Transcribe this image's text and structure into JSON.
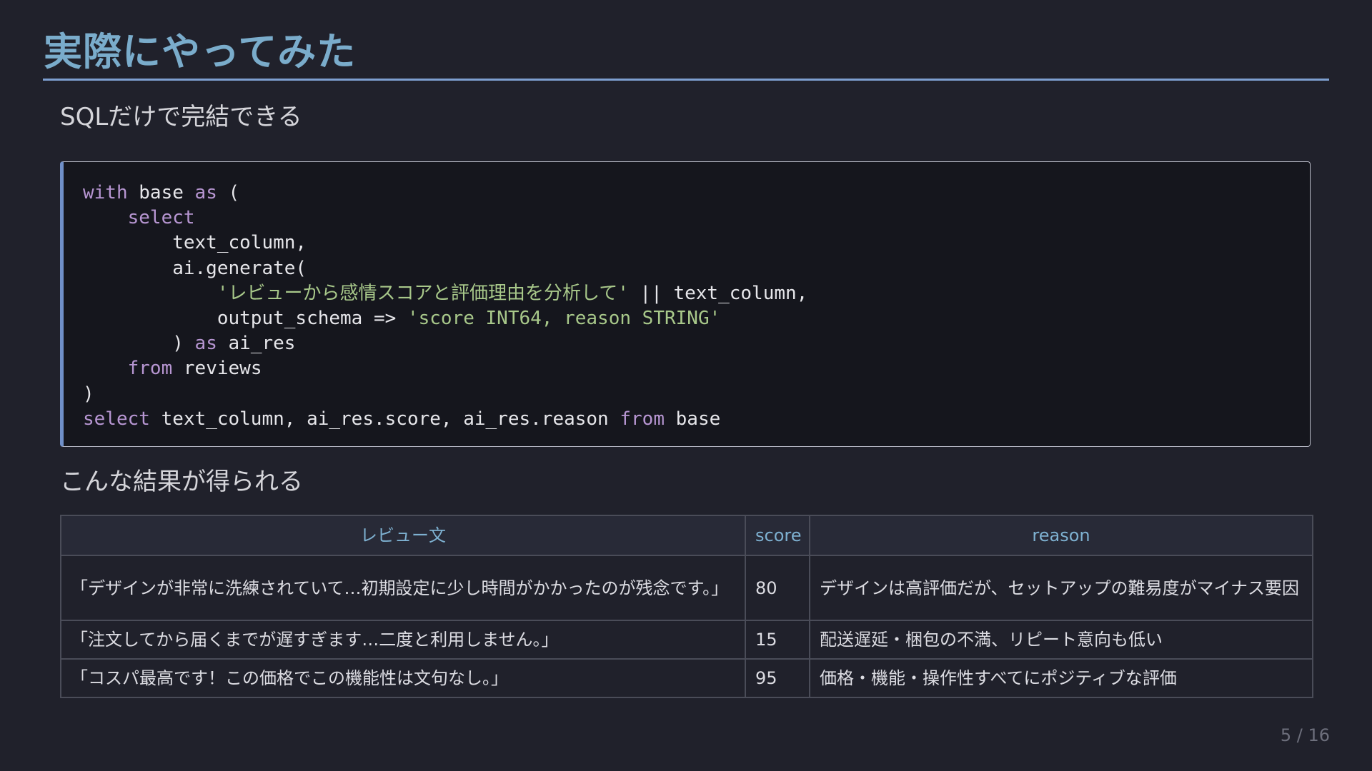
{
  "slide": {
    "title": "実際にやってみた",
    "subtitle": "SQLだけで完結できる",
    "results_heading": "こんな結果が得られる",
    "page_number": "5 / 16"
  },
  "code": {
    "language": "sql",
    "lines": [
      "with base as (",
      "    select",
      "        text_column,",
      "        ai.generate(",
      "            'レビューから感情スコアと評価理由を分析して' || text_column,",
      "            output_schema => 'score INT64, reason STRING'",
      "        ) as ai_res",
      "    from reviews",
      ")",
      "select text_column, ai_res.score, ai_res.reason from base"
    ]
  },
  "results_table": {
    "headers": [
      "レビュー文",
      "score",
      "reason"
    ],
    "rows": [
      [
        "「デザインが非常に洗練されていて…初期設定に少し時間がかかったのが残念です。」",
        "80",
        "デザインは高評価だが、セットアップの難易度がマイナス要因"
      ],
      [
        "「注文してから届くまでが遅すぎます…二度と利用しません。」",
        "15",
        "配送遅延・梱包の不満、リピート意向も低い"
      ],
      [
        "「コスパ最高です！この価格でこの機能性は文句なし。」",
        "95",
        "価格・機能・操作性すべてにポジティブな評価"
      ]
    ]
  },
  "colors": {
    "background": "#20212b",
    "title": "#7aaccb",
    "rule": "#7d9fd0",
    "code_background": "#15161d",
    "code_keyword": "#b796d2",
    "code_string": "#a8c88a",
    "table_header_text": "#7eb1d1"
  }
}
